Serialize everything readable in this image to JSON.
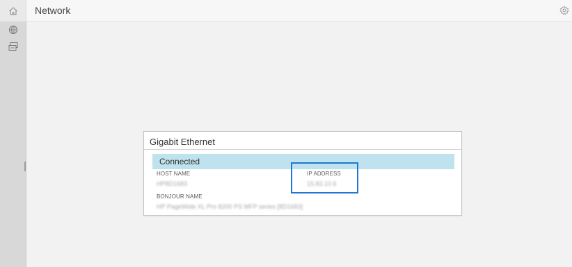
{
  "header": {
    "title": "Network",
    "home_icon": "home-icon",
    "settings_icon": "gear-icon"
  },
  "sidebar": {
    "items": [
      {
        "icon": "network-icon"
      },
      {
        "icon": "ethernet-icon"
      }
    ]
  },
  "panel": {
    "title": "Gigabit Ethernet",
    "status": "Connected",
    "fields": {
      "host_name_label": "HOST NAME",
      "host_name_value": "HP8D1683",
      "ip_address_label": "IP ADDRESS",
      "ip_address_value": "15.83.10.6",
      "bonjour_name_label": "BONJOUR NAME",
      "bonjour_name_value": "HP PageWide XL Pro 8200 PS MFP series [8D1683]"
    }
  },
  "colors": {
    "status_bar": "#bfe3ee",
    "highlight": "#1f77d0",
    "sidebar": "#d8d8d8"
  }
}
